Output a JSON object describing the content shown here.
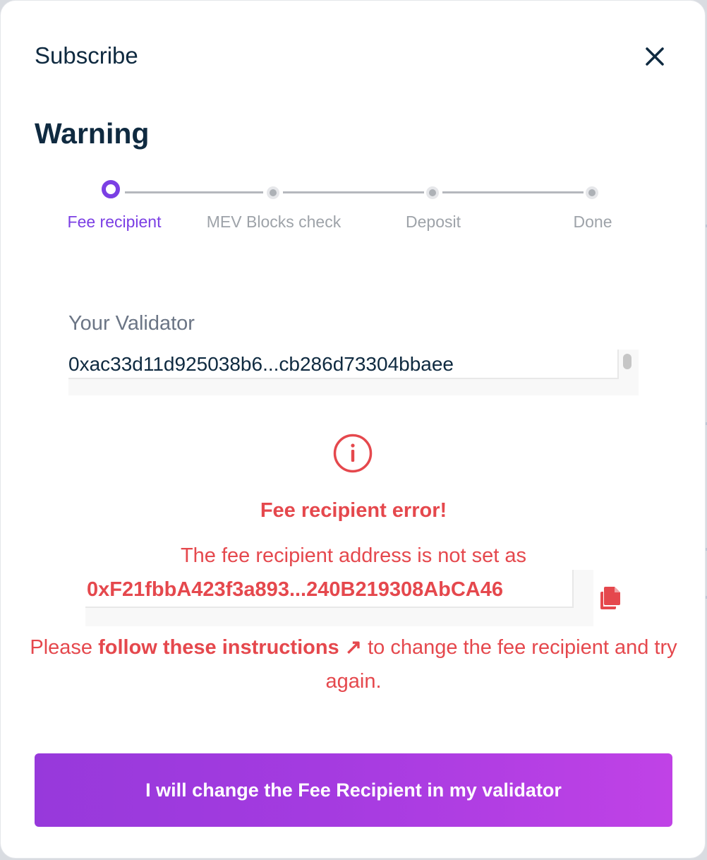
{
  "modal": {
    "title": "Subscribe",
    "heading": "Warning"
  },
  "stepper": {
    "steps": [
      {
        "label": "Fee recipient",
        "active": true
      },
      {
        "label": "MEV Blocks check",
        "active": false
      },
      {
        "label": "Deposit",
        "active": false
      },
      {
        "label": "Done",
        "active": false
      }
    ]
  },
  "validator": {
    "label": "Your Validator",
    "value": "0xac33d11d925038b6...cb286d73304bbaee"
  },
  "error": {
    "title": "Fee recipient error!",
    "message": "The fee recipient address is not set as",
    "address": "0xF21fbbA423f3a893...240B219308AbCA46",
    "instructions_prefix": "Please ",
    "instructions_link": "follow these instructions ↗",
    "instructions_suffix": " to change the fee recipient and try again."
  },
  "cta": {
    "label": "I will change the Fee Recipient in my validator"
  },
  "colors": {
    "accent_purple": "#7b3fe4",
    "error_red": "#e5484d",
    "text_dark": "#0f2a40",
    "step_inactive": "#9ea3a9"
  },
  "icons": {
    "close": "close-icon",
    "info": "info-circle-icon",
    "copy": "copy-icon",
    "external_link": "external-link-arrow-icon"
  }
}
